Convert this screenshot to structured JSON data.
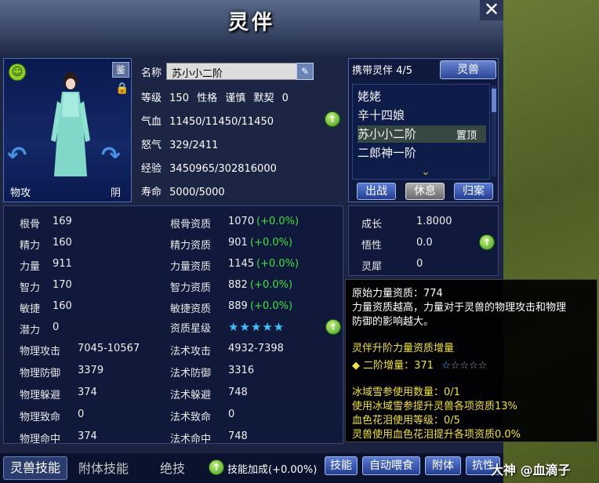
{
  "window": {
    "title": "灵伴",
    "close_symbol": "✕"
  },
  "portrait": {
    "identify_label": "鉴",
    "attack_type": "物攻",
    "element": "阴"
  },
  "info": {
    "name_label": "名称",
    "name_value": "苏小小二阶",
    "level_label": "等级",
    "level_value": "150",
    "personality_label": "性格",
    "personality_value": "谨慎",
    "tacit_label": "默契",
    "tacit_value": "0",
    "hp_label": "气血",
    "hp_value": "11450/11450/11450",
    "rage_label": "怒气",
    "rage_value": "329/2411",
    "exp_label": "经验",
    "exp_value": "3450965/302816000",
    "life_label": "寿命",
    "life_value": "5000/5000"
  },
  "companion_list": {
    "header": "携带灵伴 4/5",
    "spirit_beast_button": "灵兽",
    "items": [
      "姥姥",
      "辛十四娘",
      "苏小小二阶",
      "二郎神一阶"
    ],
    "selected_index": 2,
    "pin_label": "置顶",
    "buttons": {
      "battle": "出战",
      "rest": "休息",
      "return": "归案"
    }
  },
  "stats": {
    "left": [
      {
        "label": "根骨",
        "value": "169"
      },
      {
        "label": "精力",
        "value": "160"
      },
      {
        "label": "力量",
        "value": "911"
      },
      {
        "label": "智力",
        "value": "170"
      },
      {
        "label": "敏捷",
        "value": "160"
      },
      {
        "label": "潜力",
        "value": "0"
      },
      {
        "label": "物理攻击",
        "value": "7045-10567"
      },
      {
        "label": "物理防御",
        "value": "3379"
      },
      {
        "label": "物理躲避",
        "value": "374"
      },
      {
        "label": "物理致命",
        "value": "0"
      },
      {
        "label": "物理命中",
        "value": "374"
      }
    ],
    "right": [
      {
        "label": "根骨资质",
        "value": "1070",
        "bonus": "(+0.0%)"
      },
      {
        "label": "精力资质",
        "value": "901",
        "bonus": "(+0.0%)"
      },
      {
        "label": "力量资质",
        "value": "1145",
        "bonus": "(+0.0%)"
      },
      {
        "label": "智力资质",
        "value": "882",
        "bonus": "(+0.0%)"
      },
      {
        "label": "敏捷资质",
        "value": "889",
        "bonus": "(+0.0%)"
      },
      {
        "label": "资质星级",
        "value": "★★★★★",
        "bonus": ""
      },
      {
        "label": "法术攻击",
        "value": "4932-7398",
        "bonus": ""
      },
      {
        "label": "法术防御",
        "value": "3316",
        "bonus": ""
      },
      {
        "label": "法术躲避",
        "value": "748",
        "bonus": ""
      },
      {
        "label": "法术致命",
        "value": "0",
        "bonus": ""
      },
      {
        "label": "法术命中",
        "value": "748",
        "bonus": ""
      }
    ]
  },
  "growth": {
    "rows": [
      {
        "label": "成长",
        "value": "1.8000"
      },
      {
        "label": "悟性",
        "value": "0.0"
      },
      {
        "label": "灵犀",
        "value": "0"
      }
    ]
  },
  "tooltip": {
    "line1": "原始力量资质：774",
    "line2": "力量资质越高，力量对于灵兽的物理攻击和物理",
    "line3": "防御的影响越大。",
    "line4": "灵伴升阶力量资质增量",
    "line5_prefix": "◆ 二阶增量：371",
    "line5_stars_filled": "☆",
    "line5_stars_empty": "☆☆☆☆",
    "line6": "冰域雪参使用数量：0/1",
    "line7": "使用冰域雪参提升灵兽各项资质13%",
    "line8": "血色花泪使用等级：0/5",
    "line9": "灵兽使用血色花泪提升各项资质0.0%"
  },
  "bottom": {
    "tabs": [
      "灵兽技能",
      "附体技能",
      "绝技"
    ],
    "skill_bonus": "技能加成(+0.00%)",
    "buttons": [
      "技能",
      "自动喂食",
      "附体",
      "抗性"
    ],
    "watermark": "大神 @血滴子"
  }
}
